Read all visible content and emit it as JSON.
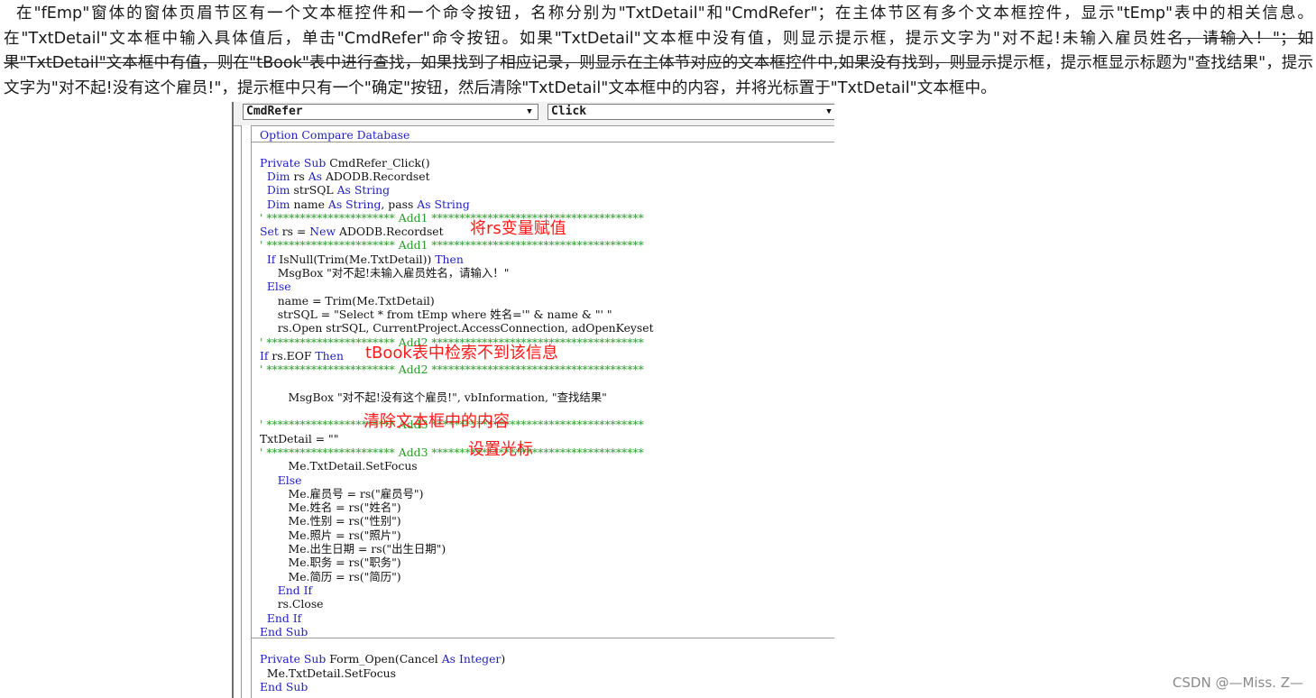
{
  "intro": {
    "line_normal": "在\"fEmp\"窗体的窗体页眉节区有一个文本框控件和一个命令按钮，名称分别为\"TxtDetail\"和\"CmdRefer\"；在主体节区有多个文本框控件，显示\"tEmp\"表中的相关信息。在\"TxtDetail\"文本框中输入具体值后，单击\"CmdRefer\"命令按钮。如果\"TxtDetail\"文本框中没有值，则显示提示框，提示文字为\"对不起!未输入雇员姓",
    "line_struck": "名，请输入！\"；如果\"TxtDetail\"文本框中有值，则在\"tBook\"表中进行查找，如果找到了相应记录，则显示在主体节对应的文本框控件中,如果没有找到，则显示",
    "line_rest": "提示框，提示框显示标题为\"查找结果\"，提示文字为\"对不起!没有这个雇员!\"，提示框中只有一个\"确定\"按钮，然后清除\"TxtDetail\"文本框中的内容，并将光标置于\"TxtDetail\"文本框中。"
  },
  "editor": {
    "object_combo": "CmdRefer",
    "procedure_combo": "Click",
    "combo_arrow": "▼",
    "lines": [
      "Option Compare Database",
      "",
      "Private Sub CmdRefer_Click()",
      "  Dim rs As ADODB.Recordset",
      "  Dim strSQL As String",
      "  Dim name As String, pass As String",
      "' *********************** Add1 **************************************",
      "Set rs = New ADODB.Recordset",
      "' *********************** Add1 **************************************",
      "  If IsNull(Trim(Me.TxtDetail)) Then",
      "     MsgBox \"对不起!未输入雇员姓名，请输入！\"",
      "  Else",
      "     name = Trim(Me.TxtDetail)",
      "     strSQL = \"Select * from tEmp where 姓名='\" & name & \"' \"",
      "     rs.Open strSQL, CurrentProject.AccessConnection, adOpenKeyset",
      "' *********************** Add2 **************************************",
      "If rs.EOF Then",
      "' *********************** Add2 **************************************",
      "",
      "        MsgBox \"对不起!没有这个雇员!\", vbInformation, \"查找结果\"",
      "",
      "' *********************** Add3 **************************************",
      "TxtDetail = \"\"",
      "' *********************** Add3 **************************************",
      "        Me.TxtDetail.SetFocus",
      "     Else",
      "        Me.雇员号 = rs(\"雇员号\")",
      "        Me.姓名 = rs(\"姓名\")",
      "        Me.性别 = rs(\"性别\")",
      "        Me.照片 = rs(\"照片\")",
      "        Me.出生日期 = rs(\"出生日期\")",
      "        Me.职务 = rs(\"职务\")",
      "        Me.简历 = rs(\"简历\")",
      "     End If",
      "     rs.Close",
      "  End If",
      "End Sub",
      "",
      "Private Sub Form_Open(Cancel As Integer)",
      "  Me.TxtDetail.SetFocus",
      "End Sub"
    ]
  },
  "annotations": [
    {
      "text": "将rs变量赋值",
      "line": 7
    },
    {
      "text": "tBook表中检索不到该信息",
      "line": 16
    },
    {
      "text": "清除文本框中的内容",
      "line": 21
    },
    {
      "text": "设置光标",
      "line": 23
    }
  ],
  "watermark": "CSDN @—Miss. Z—",
  "colors": {
    "keyword": "#1f1fbf",
    "comment": "#2a9a2a",
    "annotation": "#ff1a1a"
  }
}
